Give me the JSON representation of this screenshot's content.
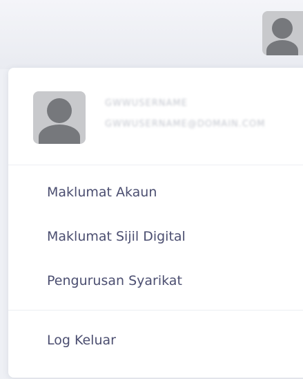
{
  "header": {
    "avatar_icon": "user-avatar-icon"
  },
  "dropdown": {
    "user": {
      "name": "GWWUSERNAME",
      "email": "GWWUSERNAME@DOMAIN.COM",
      "avatar_icon": "user-avatar-icon"
    },
    "menu": [
      {
        "label": "Maklumat Akaun"
      },
      {
        "label": "Maklumat Sijil Digital"
      },
      {
        "label": "Pengurusan Syarikat"
      }
    ],
    "logout_label": "Log Keluar"
  },
  "colors": {
    "menu_text": "#4b4e70",
    "avatar_bg": "#c8c9cc",
    "avatar_fg": "#76787c",
    "panel_bg": "#ffffff",
    "page_bg": "#eef0f5"
  }
}
